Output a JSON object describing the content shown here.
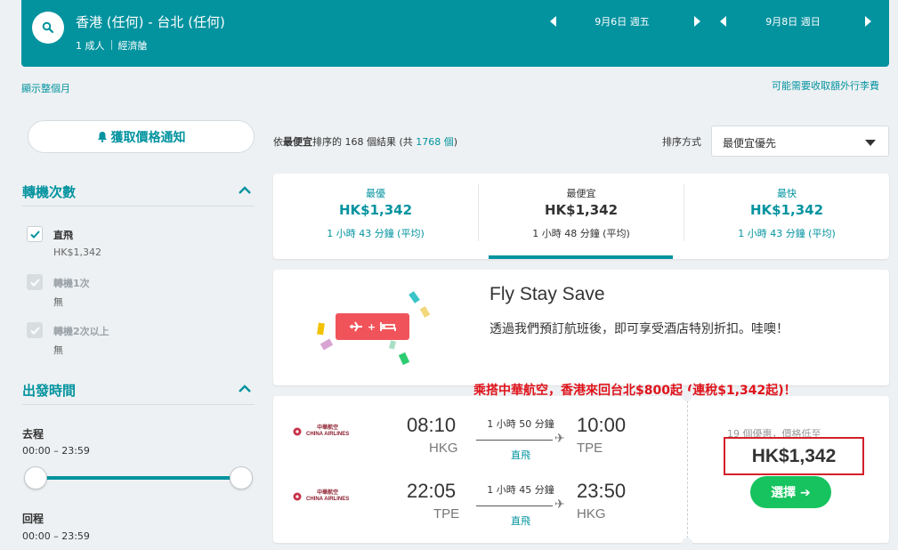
{
  "header": {
    "route": "香港 (任何) - 台北 (任何)",
    "passengers": "1 成人",
    "cabin": "經濟艙",
    "depart_date": "9月6日 週五",
    "return_date": "9月8日 週日"
  },
  "links": {
    "show_month": "顯示整個月",
    "extra_bags": "可能需要收取額外行李費"
  },
  "sidebar": {
    "price_alert": "獲取價格通知",
    "stops_title": "轉機次數",
    "stops": [
      {
        "label": "直飛",
        "sub": "HK$1,342",
        "checked": true
      },
      {
        "label": "轉機1次",
        "sub": "無",
        "checked": false
      },
      {
        "label": "轉機2次以上",
        "sub": "無",
        "checked": false
      }
    ],
    "times_title": "出發時間",
    "outbound_label": "去程",
    "outbound_range": "00:00 – 23:59",
    "return_label": "回程",
    "return_range": "00:00 – 23:59"
  },
  "results": {
    "count_prefix": "依",
    "count_sort": "最便宜",
    "count_middle": "排序的 168 個結果 (共 ",
    "count_total": "1768 個",
    "count_suffix": ")",
    "sort_label": "排序方式",
    "sort_value": "最便宜優先"
  },
  "tabs": [
    {
      "name": "最優",
      "price": "HK$1,342",
      "duration": "1 小時 43 分鐘 (平均)"
    },
    {
      "name": "最便宜",
      "price": "HK$1,342",
      "duration": "1 小時 48 分鐘 (平均)"
    },
    {
      "name": "最快",
      "price": "HK$1,342",
      "duration": "1 小時 43 分鐘 (平均)"
    }
  ],
  "promo": {
    "title": "Fly Stay Save",
    "description": "透過我們預訂航班後，即可享受酒店特別折扣。哇噢！",
    "badge_plus": "+"
  },
  "annotation": "乘搭中華航空，香港來回台北$800起 (連稅$1,342起)！",
  "flight": {
    "airline_cn": "中華航空",
    "airline_en": "CHINA AIRLINES",
    "outbound": {
      "dep_time": "08:10",
      "dep_code": "HKG",
      "duration": "1 小時 50 分鐘",
      "stops": "直飛",
      "arr_time": "10:00",
      "arr_code": "TPE"
    },
    "inbound": {
      "dep_time": "22:05",
      "dep_code": "TPE",
      "duration": "1 小時 45 分鐘",
      "stops": "直飛",
      "arr_time": "23:50",
      "arr_code": "HKG"
    },
    "deals": "19 個優惠，價格低至",
    "price": "HK$1,342",
    "select": "選擇 ➔"
  },
  "colors": {
    "accent": "#02939f",
    "cta": "#16c35e",
    "promo": "#f0545a",
    "annotation": "#e0131b"
  }
}
